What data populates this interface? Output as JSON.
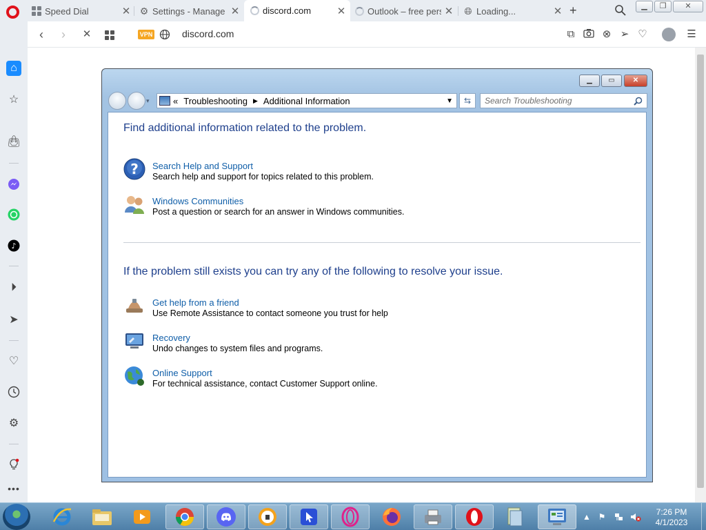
{
  "browser": {
    "tabs": [
      {
        "label": "Speed Dial",
        "icon": "speed-dial-icon"
      },
      {
        "label": "Settings - Manage",
        "icon": "gear-icon"
      },
      {
        "label": "discord.com",
        "icon": "loading-spinner-icon",
        "active": true
      },
      {
        "label": "Outlook – free pers",
        "icon": "loading-spinner-icon"
      },
      {
        "label": "Loading...",
        "icon": "globe-icon"
      }
    ],
    "vpn_label": "VPN",
    "url": "discord.com"
  },
  "dialog": {
    "breadcrumb": {
      "overflow": "«",
      "items": [
        "Troubleshooting",
        "Additional Information"
      ]
    },
    "search_placeholder": "Search Troubleshooting",
    "section1": {
      "heading": "Find additional information related to the problem.",
      "items": [
        {
          "title": "Search Help and Support",
          "description": "Search help and support for topics related to this problem.",
          "icon": "help-question-icon"
        },
        {
          "title": "Windows Communities",
          "description": "Post a question or search for an answer in Windows communities.",
          "icon": "community-users-icon"
        }
      ]
    },
    "section2": {
      "heading": "If the problem still exists you can try any of the following to resolve your issue.",
      "items": [
        {
          "title": "Get help from a friend",
          "description": "Use Remote Assistance to contact someone you trust for help",
          "icon": "remote-assistance-icon"
        },
        {
          "title": "Recovery",
          "description": "Undo changes to system files and programs.",
          "icon": "recovery-icon"
        },
        {
          "title": "Online Support",
          "description": "For technical assistance, contact Customer Support online.",
          "icon": "online-support-globe-icon"
        }
      ]
    }
  },
  "taskbar": {
    "time": "7:26 PM",
    "date": "4/1/2023"
  },
  "colors": {
    "opera_red": "#e0121b",
    "link_blue": "#0f5ea8",
    "heading_blue": "#1e3f8c",
    "vpn_orange": "#f5a623"
  }
}
